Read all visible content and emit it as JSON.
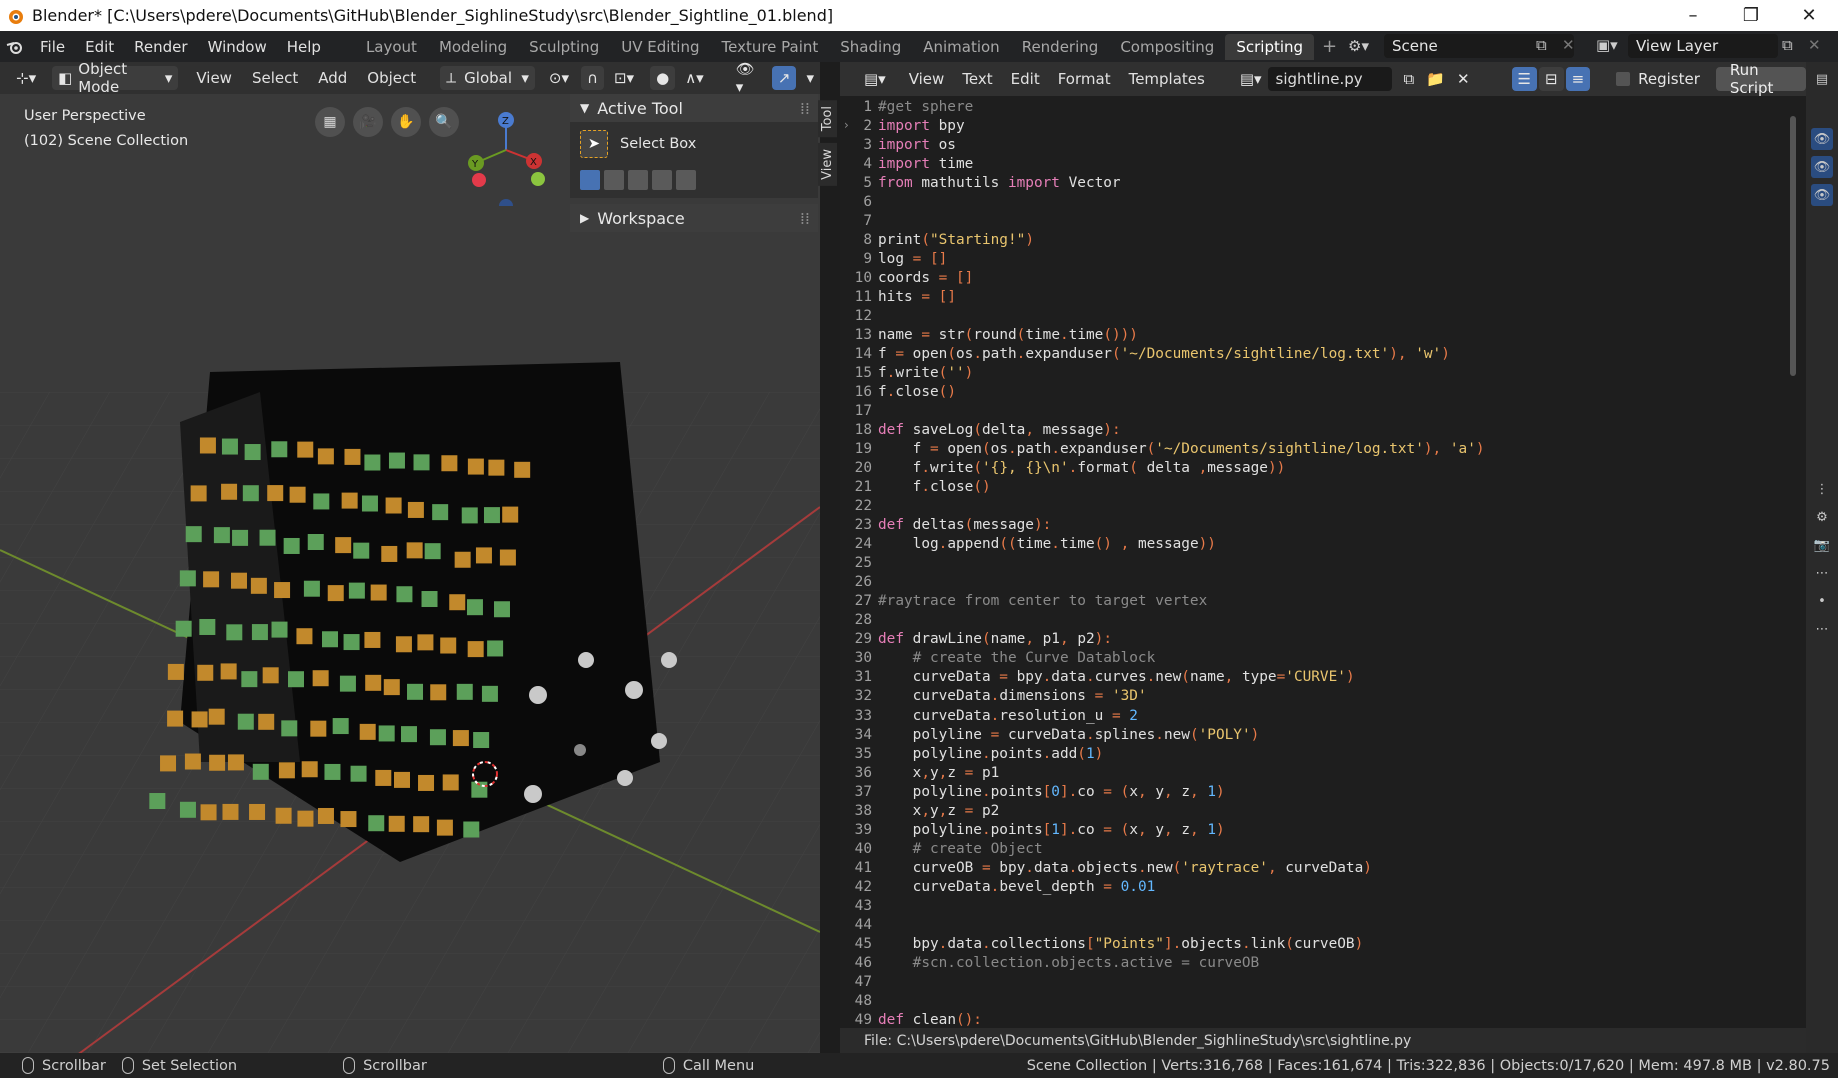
{
  "window": {
    "title": "Blender* [C:\\Users\\pdere\\Documents\\GitHub\\Blender_SighlineStudy\\src\\Blender_Sightline_01.blend]",
    "min": "–",
    "max": "❐",
    "close": "✕"
  },
  "topbar": {
    "menus": [
      "File",
      "Edit",
      "Render",
      "Window",
      "Help"
    ],
    "workspaces": [
      "Layout",
      "Modeling",
      "Sculpting",
      "UV Editing",
      "Texture Paint",
      "Shading",
      "Animation",
      "Rendering",
      "Compositing",
      "Scripting"
    ],
    "active_workspace": "Scripting",
    "add": "+",
    "scene": "Scene",
    "view_layer": "View Layer"
  },
  "viewport": {
    "mode": "Object Mode",
    "menus": [
      "View",
      "Select",
      "Add",
      "Object"
    ],
    "orientation": "Global",
    "perspective": "User Perspective",
    "collection": "(102) Scene Collection",
    "axes": {
      "x": "X",
      "y": "Y",
      "z": "Z"
    },
    "active_tool_title": "Active Tool",
    "tool_name": "Select Box",
    "workspace_title": "Workspace",
    "tab_tool": "Tool",
    "tab_view": "View"
  },
  "editor": {
    "menus": [
      "View",
      "Text",
      "Edit",
      "Format",
      "Templates"
    ],
    "filename": "sightline.py",
    "register": "Register",
    "run": "Run Script",
    "footer": "File: C:\\Users\\pdere\\Documents\\GitHub\\Blender_SighlineStudy\\src\\sightline.py",
    "lines": [
      {
        "n": "1",
        "h": "<span class='c-com'>#get sphere</span>"
      },
      {
        "n": "2",
        "h": "<span class='c-kw'>import</span> bpy"
      },
      {
        "n": "3",
        "h": "<span class='c-kw'>import</span> os"
      },
      {
        "n": "4",
        "h": "<span class='c-kw'>import</span> time"
      },
      {
        "n": "5",
        "h": "<span class='c-kw'>from</span> mathutils <span class='c-kw'>import</span> Vector"
      },
      {
        "n": "6",
        "h": ""
      },
      {
        "n": "7",
        "h": ""
      },
      {
        "n": "8",
        "h": "print<span class='c-sym'>(</span><span class='c-str'>\"Starting!\"</span><span class='c-sym'>)</span>"
      },
      {
        "n": "9",
        "h": "log <span class='c-sym'>=</span> <span class='c-sym'>[]</span>"
      },
      {
        "n": "10",
        "h": "coords <span class='c-sym'>=</span> <span class='c-sym'>[]</span>"
      },
      {
        "n": "11",
        "h": "hits <span class='c-sym'>=</span> <span class='c-sym'>[]</span>"
      },
      {
        "n": "12",
        "h": ""
      },
      {
        "n": "13",
        "h": "name <span class='c-sym'>=</span> str<span class='c-sym'>(</span>round<span class='c-sym'>(</span>time<span class='c-sym'>.</span>time<span class='c-sym'>()))</span>"
      },
      {
        "n": "14",
        "h": "f <span class='c-sym'>=</span> open<span class='c-sym'>(</span>os<span class='c-sym'>.</span>path<span class='c-sym'>.</span>expanduser<span class='c-sym'>(</span><span class='c-str'>'~/Documents/sightline/log.txt'</span><span class='c-sym'>),</span> <span class='c-str'>'w'</span><span class='c-sym'>)</span>"
      },
      {
        "n": "15",
        "h": "f<span class='c-sym'>.</span>write<span class='c-sym'>(</span><span class='c-str'>''</span><span class='c-sym'>)</span>"
      },
      {
        "n": "16",
        "h": "f<span class='c-sym'>.</span>close<span class='c-sym'>()</span>"
      },
      {
        "n": "17",
        "h": ""
      },
      {
        "n": "18",
        "h": "<span class='c-kw'>def</span> saveLog<span class='c-sym'>(</span>delta<span class='c-sym'>,</span> message<span class='c-sym'>):</span>"
      },
      {
        "n": "19",
        "h": "    f <span class='c-sym'>=</span> open<span class='c-sym'>(</span>os<span class='c-sym'>.</span>path<span class='c-sym'>.</span>expanduser<span class='c-sym'>(</span><span class='c-str'>'~/Documents/sightline/log.txt'</span><span class='c-sym'>),</span> <span class='c-str'>'a'</span><span class='c-sym'>)</span>"
      },
      {
        "n": "20",
        "h": "    f<span class='c-sym'>.</span>write<span class='c-sym'>(</span><span class='c-str'>'{}, {}\\n'</span><span class='c-sym'>.</span>format<span class='c-sym'>(</span> delta <span class='c-sym'>,</span>message<span class='c-sym'>))</span>"
      },
      {
        "n": "21",
        "h": "    f<span class='c-sym'>.</span>close<span class='c-sym'>()</span>"
      },
      {
        "n": "22",
        "h": ""
      },
      {
        "n": "23",
        "h": "<span class='c-kw'>def</span> deltas<span class='c-sym'>(</span>message<span class='c-sym'>):</span>"
      },
      {
        "n": "24",
        "h": "    log<span class='c-sym'>.</span>append<span class='c-sym'>((</span>time<span class='c-sym'>.</span>time<span class='c-sym'>()</span> <span class='c-sym'>,</span> message<span class='c-sym'>))</span>"
      },
      {
        "n": "25",
        "h": ""
      },
      {
        "n": "26",
        "h": ""
      },
      {
        "n": "27",
        "h": "<span class='c-com'>#raytrace from center to target vertex</span>"
      },
      {
        "n": "28",
        "h": ""
      },
      {
        "n": "29",
        "h": "<span class='c-kw'>def</span> drawLine<span class='c-sym'>(</span>name<span class='c-sym'>,</span> p1<span class='c-sym'>,</span> p2<span class='c-sym'>):</span>"
      },
      {
        "n": "30",
        "h": "    <span class='c-com'># create the Curve Datablock</span>"
      },
      {
        "n": "31",
        "h": "    curveData <span class='c-sym'>=</span> bpy<span class='c-sym'>.</span>data<span class='c-sym'>.</span>curves<span class='c-sym'>.</span>new<span class='c-sym'>(</span>name<span class='c-sym'>,</span> type<span class='c-sym'>=</span><span class='c-str'>'CURVE'</span><span class='c-sym'>)</span>"
      },
      {
        "n": "32",
        "h": "    curveData<span class='c-sym'>.</span>dimensions <span class='c-sym'>=</span> <span class='c-str'>'3D'</span>"
      },
      {
        "n": "33",
        "h": "    curveData<span class='c-sym'>.</span>resolution_u <span class='c-sym'>=</span> <span class='c-num'>2</span>"
      },
      {
        "n": "34",
        "h": "    polyline <span class='c-sym'>=</span> curveData<span class='c-sym'>.</span>splines<span class='c-sym'>.</span>new<span class='c-sym'>(</span><span class='c-str'>'POLY'</span><span class='c-sym'>)</span>"
      },
      {
        "n": "35",
        "h": "    polyline<span class='c-sym'>.</span>points<span class='c-sym'>.</span>add<span class='c-sym'>(</span><span class='c-num'>1</span><span class='c-sym'>)</span>"
      },
      {
        "n": "36",
        "h": "    x<span class='c-sym'>,</span>y<span class='c-sym'>,</span>z <span class='c-sym'>=</span> p1"
      },
      {
        "n": "37",
        "h": "    polyline<span class='c-sym'>.</span>points<span class='c-sym'>[</span><span class='c-num'>0</span><span class='c-sym'>].</span>co <span class='c-sym'>=</span> <span class='c-sym'>(</span>x<span class='c-sym'>,</span> y<span class='c-sym'>,</span> z<span class='c-sym'>,</span> <span class='c-num'>1</span><span class='c-sym'>)</span>"
      },
      {
        "n": "38",
        "h": "    x<span class='c-sym'>,</span>y<span class='c-sym'>,</span>z <span class='c-sym'>=</span> p2"
      },
      {
        "n": "39",
        "h": "    polyline<span class='c-sym'>.</span>points<span class='c-sym'>[</span><span class='c-num'>1</span><span class='c-sym'>].</span>co <span class='c-sym'>=</span> <span class='c-sym'>(</span>x<span class='c-sym'>,</span> y<span class='c-sym'>,</span> z<span class='c-sym'>,</span> <span class='c-num'>1</span><span class='c-sym'>)</span>"
      },
      {
        "n": "40",
        "h": "    <span class='c-com'># create Object</span>"
      },
      {
        "n": "41",
        "h": "    curveOB <span class='c-sym'>=</span> bpy<span class='c-sym'>.</span>data<span class='c-sym'>.</span>objects<span class='c-sym'>.</span>new<span class='c-sym'>(</span><span class='c-str'>'raytrace'</span><span class='c-sym'>,</span> curveData<span class='c-sym'>)</span>"
      },
      {
        "n": "42",
        "h": "    curveData<span class='c-sym'>.</span>bevel_depth <span class='c-sym'>=</span> <span class='c-num'>0.01</span>"
      },
      {
        "n": "43",
        "h": ""
      },
      {
        "n": "44",
        "h": ""
      },
      {
        "n": "45",
        "h": "    bpy<span class='c-sym'>.</span>data<span class='c-sym'>.</span>collections<span class='c-sym'>[</span><span class='c-str'>\"Points\"</span><span class='c-sym'>].</span>objects<span class='c-sym'>.</span>link<span class='c-sym'>(</span>curveOB<span class='c-sym'>)</span>"
      },
      {
        "n": "46",
        "h": "    <span class='c-com'>#scn.collection.objects.active = curveOB</span>"
      },
      {
        "n": "47",
        "h": ""
      },
      {
        "n": "48",
        "h": ""
      },
      {
        "n": "49",
        "h": "<span class='c-kw'>def</span> clean<span class='c-sym'>():</span>"
      }
    ]
  },
  "status": {
    "left": [
      "Scrollbar",
      "Set Selection",
      "Scrollbar",
      "Call Menu"
    ],
    "stats": "Scene Collection | Verts:316,768 | Faces:161,674 | Tris:322,836 | Objects:0/17,620 | Mem: 497.8 MB | v2.80.75"
  }
}
